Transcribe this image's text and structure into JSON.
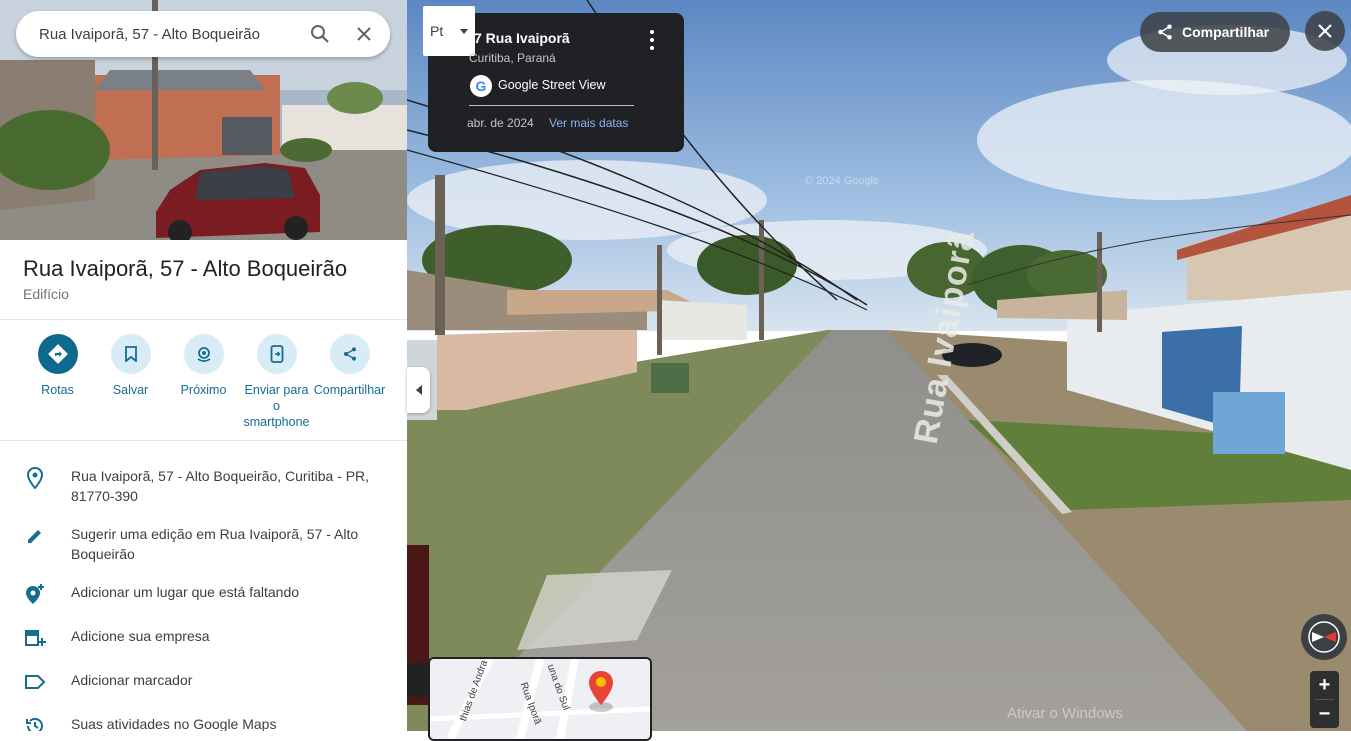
{
  "search": {
    "value": "Rua Ivaiporã, 57 - Alto Boqueirão"
  },
  "place": {
    "title": "Rua Ivaiporã, 57 - Alto Boqueirão",
    "type": "Edifício"
  },
  "actions": [
    {
      "label": "Rotas",
      "icon": "directions-icon"
    },
    {
      "label": "Salvar",
      "icon": "bookmark-icon"
    },
    {
      "label": "Próximo",
      "icon": "nearby-icon"
    },
    {
      "label": "Enviar para o smartphone",
      "icon": "send-to-phone-icon"
    },
    {
      "label": "Compartilhar",
      "icon": "share-icon"
    }
  ],
  "info": [
    {
      "text": "Rua Ivaiporã, 57 - Alto Boqueirão, Curitiba - PR, 81770-390",
      "icon": "location-pin-icon"
    },
    {
      "text": "Sugerir uma edição em Rua Ivaiporã, 57 - Alto Boqueirão",
      "icon": "edit-pencil-icon"
    },
    {
      "text": "Adicionar um lugar que está faltando",
      "icon": "add-place-icon"
    },
    {
      "text": "Adicione sua empresa",
      "icon": "add-business-icon"
    },
    {
      "text": "Adicionar marcador",
      "icon": "label-icon"
    },
    {
      "text": "Suas atividades no Google Maps",
      "icon": "history-icon"
    }
  ],
  "streetview": {
    "street": "7 Rua Ivaiporã",
    "city": "Curitiba, Paraná",
    "source": "Google Street View",
    "date": "abr. de 2024",
    "more_dates": "Ver mais datas",
    "layers_label": "Pt",
    "road_marking": "Rua Ivaiporã",
    "copyright": "© 2024 Google",
    "windows_watermark": "Ativar o Windows"
  },
  "topbar": {
    "share_label": "Compartilhar"
  },
  "zoom": {
    "in": "+",
    "out": "−"
  },
  "minimap": {
    "streets": [
      "Rua Iporã",
      "thias de Andra",
      "una do Sul"
    ]
  },
  "colors": {
    "accent": "#0b57d0",
    "card_bg": "#202124",
    "link": "#8ab4f8"
  }
}
